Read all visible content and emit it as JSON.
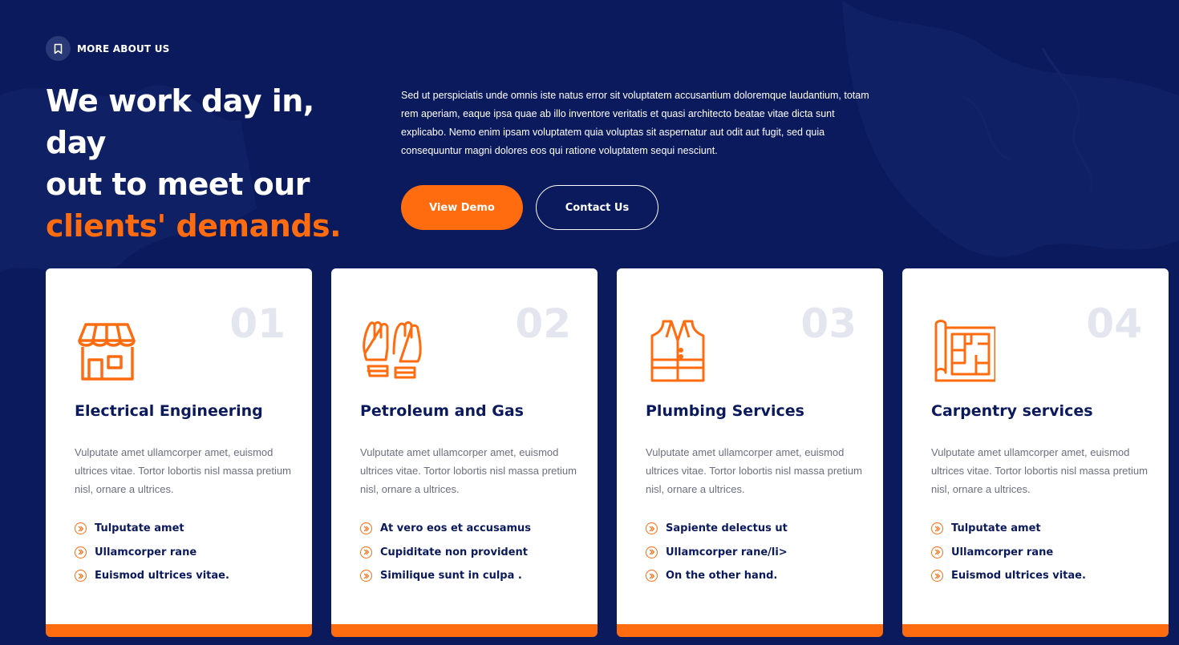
{
  "colors": {
    "background": "#0b1a5c",
    "accent": "#ff6b0f",
    "card": "#ffffff",
    "number": "#e3e6ee"
  },
  "eyebrow": {
    "icon": "bookmark-icon",
    "label": "MORE ABOUT US"
  },
  "headline": {
    "line1": "We work day in, day",
    "line2": "out to meet our",
    "accent": "clients' demands."
  },
  "intro": "Sed ut perspiciatis unde omnis iste natus error sit voluptatem accusantium doloremque laudantium, totam rem aperiam, eaque ipsa quae ab illo inventore veritatis et quasi architecto beatae vitae dicta sunt explicabo. Nemo enim ipsam voluptatem quia voluptas sit aspernatur aut odit aut fugit, sed quia consequuntur magni dolores eos qui ratione voluptatem sequi nesciunt.",
  "buttons": {
    "primary": "View Demo",
    "secondary": "Contact Us"
  },
  "cards": [
    {
      "number": "01",
      "icon": "shop-icon",
      "title": "Electrical Engineering",
      "desc": "Vulputate amet ullamcorper amet, euismod ultrices vitae. Tortor lobortis nisl massa pretium nisl, ornare a ultrices.",
      "items": [
        "Tulputate amet",
        "Ullamcorper rane",
        "Euismod ultrices vitae."
      ]
    },
    {
      "number": "02",
      "icon": "gloves-icon",
      "title": "Petroleum and Gas",
      "desc": "Vulputate amet ullamcorper amet, euismod ultrices vitae. Tortor lobortis nisl massa pretium nisl, ornare a ultrices.",
      "items": [
        "At vero eos et accusamus",
        "Cupiditate non provident",
        "Similique sunt in culpa ."
      ]
    },
    {
      "number": "03",
      "icon": "safety-vest-icon",
      "title": "Plumbing Services",
      "desc": "Vulputate amet ullamcorper amet, euismod ultrices vitae. Tortor lobortis nisl massa pretium nisl, ornare a ultrices.",
      "items": [
        "Sapiente delectus ut",
        "Ullamcorper rane/li>",
        "On the other hand."
      ]
    },
    {
      "number": "04",
      "icon": "blueprint-icon",
      "title": "Carpentry services",
      "desc": "Vulputate amet ullamcorper amet, euismod ultrices vitae. Tortor lobortis nisl massa pretium nisl, ornare a ultrices.",
      "items": [
        "Tulputate amet",
        "Ullamcorper rane",
        "Euismod ultrices vitae."
      ]
    }
  ]
}
